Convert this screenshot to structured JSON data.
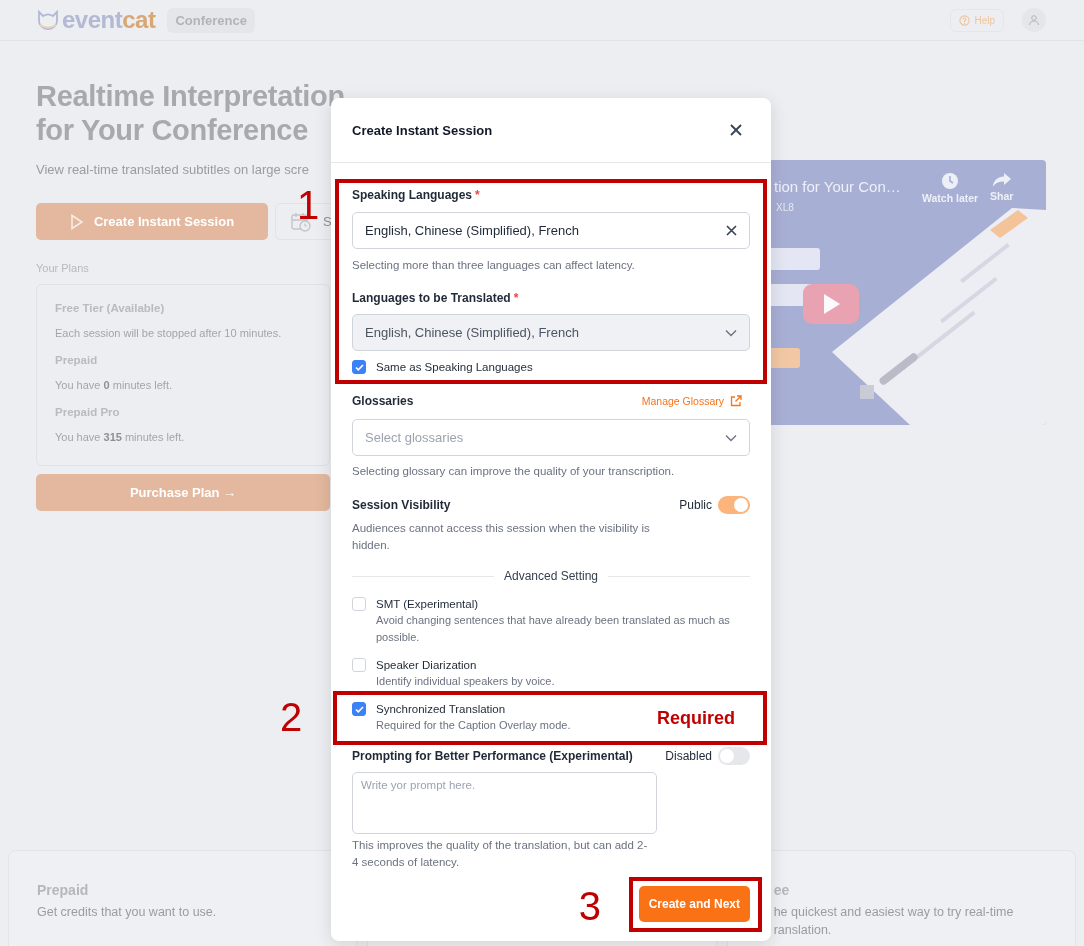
{
  "header": {
    "logo": {
      "primary": "event",
      "accent": "cat"
    },
    "badge": "Conference",
    "help": "Help"
  },
  "hero": {
    "title_lines": [
      "Realtime Interpretation",
      "for Your Conference"
    ],
    "subtitle": "View real-time translated subtitles on large scre",
    "primary_button": "Create Instant Session",
    "secondary_button": "S"
  },
  "plans": {
    "heading": "Your Plans",
    "items": [
      {
        "name": "Free Tier (Available)",
        "detail": "Each session will be stopped after 10 minutes."
      },
      {
        "name": "Prepaid",
        "detail": "You have **0** minutes left."
      },
      {
        "name": "Prepaid Pro",
        "detail": "You have **315** minutes left."
      }
    ],
    "button": "Purchase Plan →"
  },
  "video": {
    "title": "tion for Your Con…",
    "channel": "XL8",
    "actions": [
      {
        "kind": "clock",
        "label": "Watch later"
      },
      {
        "kind": "share",
        "label": "Shar"
      }
    ]
  },
  "cards": [
    {
      "title": "Prepaid",
      "lines": [
        "Get credits that you want to use."
      ]
    },
    {
      "title": "ee",
      "lines": [
        "he quickest and easiest way to try real-time",
        "ranslation."
      ]
    }
  ],
  "modal": {
    "title": "Create Instant Session",
    "languages": {
      "annotation": {
        "number": "1"
      },
      "speaking": {
        "label": "Speaking Languages",
        "required_mark": "*",
        "value": "English, Chinese (Simplified), French",
        "help": "Selecting more than three languages can affect latency."
      },
      "translated": {
        "label": "Languages to be Translated",
        "required_mark": "*",
        "value": "English, Chinese (Simplified), French",
        "disabled": true
      },
      "same_as": {
        "label": "Same as Speaking Languages",
        "checked": true
      }
    },
    "glossaries": {
      "label": "Glossaries",
      "link": "Manage Glossary",
      "placeholder": "Select glossaries",
      "help": "Selecting glossary can improve the quality of your transcription."
    },
    "visibility": {
      "label": "Session Visibility",
      "state_label": "Public",
      "on": true,
      "help": "Audiences cannot access this session when the visibility is hidden."
    },
    "advanced": {
      "heading": "Advanced Setting",
      "options": [
        {
          "label": "SMT (Experimental)",
          "description": "Avoid changing sentences that have already been translated as much as possible.",
          "checked": false
        },
        {
          "label": "Speaker Diarization",
          "description": "Identify individual speakers by voice.",
          "checked": false
        },
        {
          "label": "Synchronized Translation",
          "description": "Required for the Caption Overlay mode.",
          "checked": true,
          "annotation": {
            "number": "2",
            "note": "Required"
          }
        }
      ]
    },
    "prompting": {
      "label": "Prompting for Better Performance (Experimental)",
      "state_label": "Disabled",
      "on": false,
      "placeholder": "Write yor prompt here.",
      "help": "This improves the quality of the translation, but can add 2-4 seconds of latency."
    },
    "submit": {
      "label": "Create and Next",
      "annotation": {
        "number": "3"
      }
    }
  }
}
